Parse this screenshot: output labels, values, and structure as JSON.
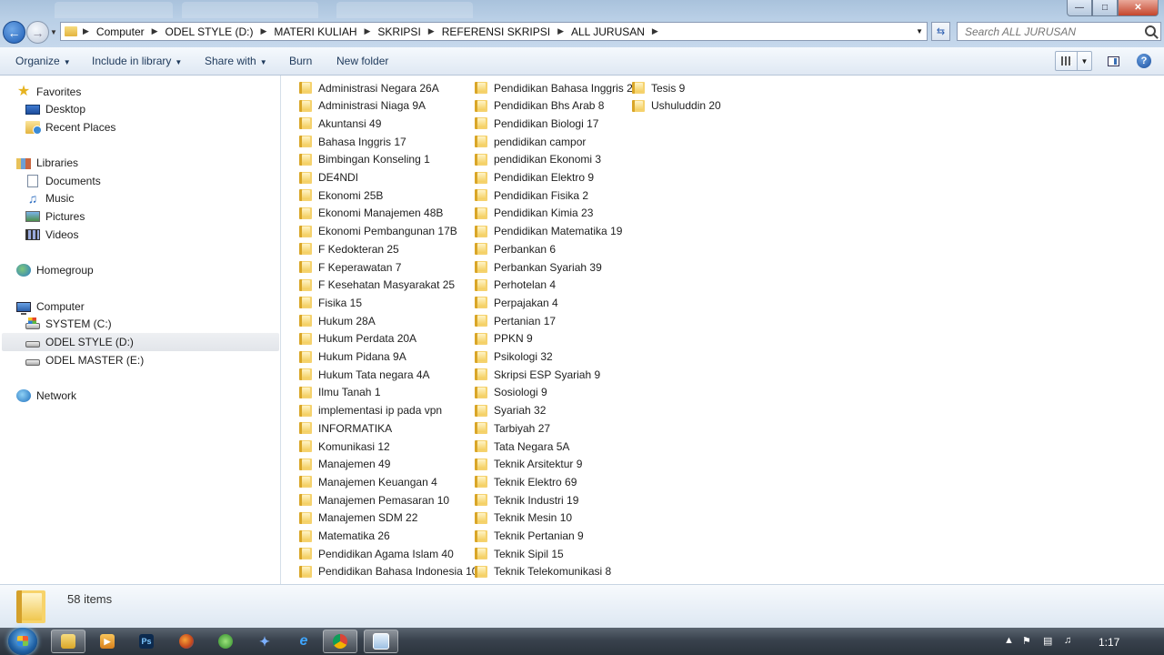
{
  "address": {
    "crumbs": [
      "Computer",
      "ODEL STYLE (D:)",
      "MATERI KULIAH",
      "SKRIPSI",
      "REFERENSI SKRIPSI",
      "ALL JURUSAN"
    ]
  },
  "search": {
    "placeholder": "Search ALL JURUSAN"
  },
  "toolbar": {
    "organize": "Organize",
    "include": "Include in library",
    "share": "Share with",
    "burn": "Burn",
    "new_folder": "New folder"
  },
  "nav": {
    "favorites": "Favorites",
    "desktop": "Desktop",
    "recent": "Recent Places",
    "libraries": "Libraries",
    "documents": "Documents",
    "music": "Music",
    "pictures": "Pictures",
    "videos": "Videos",
    "homegroup": "Homegroup",
    "computer": "Computer",
    "system": "SYSTEM (C:)",
    "odel_style": "ODEL STYLE (D:)",
    "odel_master": "ODEL MASTER (E:)",
    "network": "Network"
  },
  "files": {
    "col1": [
      "Administrasi Negara 26A",
      "Administrasi Niaga 9A",
      "Akuntansi 49",
      "Bahasa Inggris 17",
      "Bimbingan Konseling 1",
      "DE4NDI",
      "Ekonomi 25B",
      "Ekonomi Manajemen 48B",
      "Ekonomi Pembangunan 17B",
      "F Kedokteran 25",
      "F Keperawatan 7",
      "F Kesehatan Masyarakat 25",
      "Fisika 15",
      "Hukum 28A",
      "Hukum Perdata 20A",
      "Hukum Pidana 9A",
      "Hukum Tata negara 4A",
      "Ilmu Tanah 1",
      "implementasi ip pada vpn",
      "INFORMATIKA",
      "Komunikasi 12",
      "Manajemen 49",
      "Manajemen Keuangan 4",
      "Manajemen Pemasaran 10",
      "Manajemen SDM 22",
      "Matematika 26",
      "Pendidikan Agama Islam 40",
      "Pendidikan Bahasa Indonesia 10"
    ],
    "col2": [
      "Pendidikan Bahasa Inggris 2",
      "Pendidikan Bhs Arab 8",
      "Pendidikan Biologi 17",
      "pendidikan campor",
      "pendidikan Ekonomi 3",
      "Pendidikan Elektro 9",
      "Pendidikan Fisika 2",
      "Pendidikan Kimia 23",
      "Pendidikan Matematika 19",
      "Perbankan 6",
      "Perbankan Syariah 39",
      "Perhotelan 4",
      "Perpajakan 4",
      "Pertanian 17",
      "PPKN 9",
      "Psikologi 32",
      "Skripsi ESP Syariah 9",
      "Sosiologi 9",
      "Syariah 32",
      "Tarbiyah 27",
      "Tata Negara 5A",
      "Teknik Arsitektur 9",
      "Teknik Elektro 69",
      "Teknik Industri 19",
      "Teknik Mesin 10",
      "Teknik Pertanian 9",
      "Teknik Sipil 15",
      "Teknik Telekomunikasi 8"
    ],
    "col3": [
      "Tesis 9",
      "Ushuluddin 20"
    ]
  },
  "status": {
    "item_count": "58 items"
  },
  "taskbar": {
    "clock": "1:17",
    "ps_label": "Ps"
  }
}
